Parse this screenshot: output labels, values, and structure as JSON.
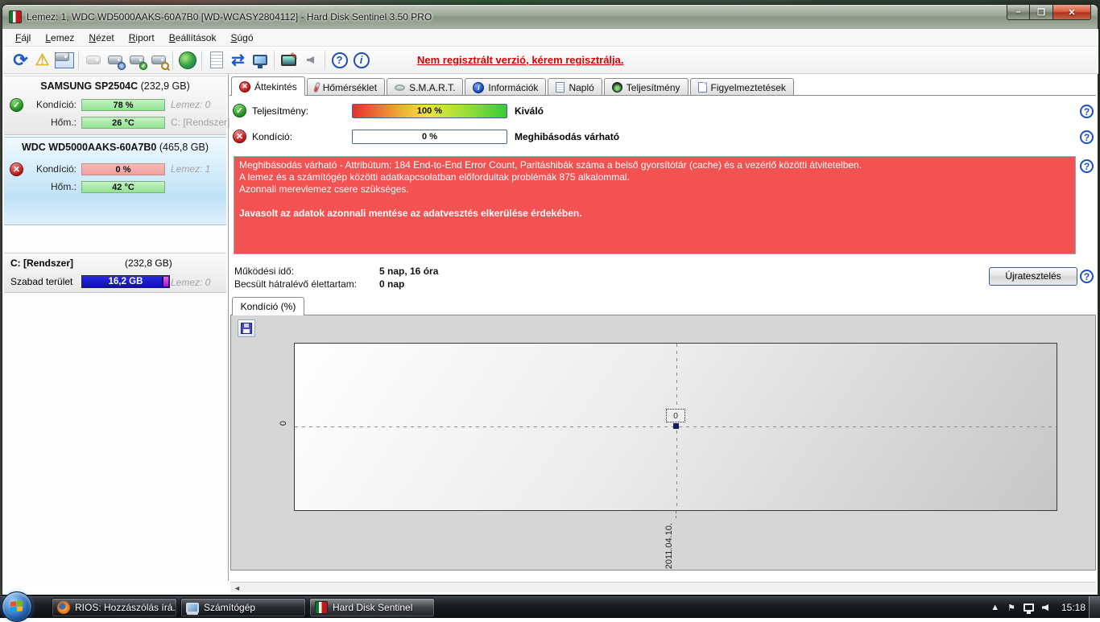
{
  "window": {
    "title": "Lemez: 1, WDC WD5000AAKS-60A7B0 [WD-WCASY2804112]  -  Hard Disk Sentinel 3.50 PRO",
    "minimize": "–",
    "maximize": "❐",
    "close": "✕"
  },
  "menu": {
    "items": [
      {
        "label": "Fájl"
      },
      {
        "label": "Lemez"
      },
      {
        "label": "Nézet"
      },
      {
        "label": "Riport"
      },
      {
        "label": "Beállítások"
      },
      {
        "label": "Súgó"
      }
    ]
  },
  "toolbar": {
    "icons": [
      "refresh-icon",
      "warning-icon",
      "disk-frame-icon",
      "disk-detect-icon",
      "disk-clock-icon",
      "disk-check-icon",
      "disk-search-icon",
      "globe-icon",
      "report-icon",
      "sync-icon",
      "network-computer-icon",
      "monitor-edit-icon",
      "sound-icon",
      "help-icon",
      "info-icon"
    ],
    "register_link": "Nem regisztrált verzió, kérem regisztrálja."
  },
  "sidebar": {
    "disks": [
      {
        "name": "SAMSUNG SP2504C",
        "size": "(232,9 GB)",
        "condition_label": "Kondíció:",
        "condition_value": "78 %",
        "disk_label": "Lemez: 0",
        "temp_label": "Hőm.:",
        "temp_value": "26 °C",
        "drive_label": "C: [Rendszer]"
      },
      {
        "name": "WDC WD5000AAKS-60A7B0",
        "size": "(465,8 GB)",
        "condition_label": "Kondíció:",
        "condition_value": "0 %",
        "disk_label": "Lemez: 1",
        "temp_label": "Hőm.:",
        "temp_value": "42 °C"
      }
    ],
    "partition": {
      "name": "C: [Rendszer]",
      "size": "(232,8 GB)",
      "free_label": "Szabad terület",
      "free_value": "16,2 GB",
      "disk_label": "Lemez: 0"
    }
  },
  "tabs": [
    {
      "label": "Áttekintés"
    },
    {
      "label": "Hőmérséklet"
    },
    {
      "label": "S.M.A.R.T."
    },
    {
      "label": "Információk"
    },
    {
      "label": "Napló"
    },
    {
      "label": "Teljesítmény"
    },
    {
      "label": "Figyelmeztetések"
    }
  ],
  "overview": {
    "performance_label": "Teljesítmény:",
    "performance_value": "100 %",
    "performance_rating": "Kiváló",
    "condition_label": "Kondíció:",
    "condition_value": "0 %",
    "condition_rating": "Meghibásodás várható",
    "alert_line1": "Meghibásodás várható - Attribútum: 184 End-to-End Error Count, Paritáshibák száma a belső gyorsítótár (cache) és a vezérlő közötti átvitetelben.",
    "alert_line2": "A lemez és a számítógép közötti adatkapcsolatban előfordultak problémák 875 alkalommal.",
    "alert_line3": "Azonnali merevlemez csere szükséges.",
    "alert_bold": "Javasolt az adatok azonnali mentése az adatvesztés elkerülése érdekében.",
    "uptime_label": "Működési idő:",
    "uptime_value": "5 nap, 16 óra",
    "lifetime_label": "Becsült hátralévő élettartam:",
    "lifetime_value": "0 nap",
    "retest_button": "Újratesztelés"
  },
  "chart_data": {
    "type": "line",
    "title": "Kondíció  (%)",
    "x": [
      "2011.04.10."
    ],
    "series": [
      {
        "name": "Kondíció",
        "values": [
          0
        ]
      }
    ],
    "y_ticks": [
      "0"
    ],
    "point_labels": [
      "0"
    ],
    "ylim": [
      0,
      0
    ],
    "grid": true,
    "legend": false
  },
  "taskbar": {
    "buttons": [
      {
        "label": "RIOS: Hozzászólás írá..."
      },
      {
        "label": "Számítógép"
      },
      {
        "label": "Hard Disk Sentinel"
      }
    ],
    "clock": "15:18"
  },
  "colors": {
    "alert_red": "#f25252",
    "bar_green": "#92e392",
    "bar_red": "#efa0a0",
    "free_blue": "#0f0fae",
    "accent_blue": "#1d4fbf",
    "register_red": "#dd0000"
  }
}
